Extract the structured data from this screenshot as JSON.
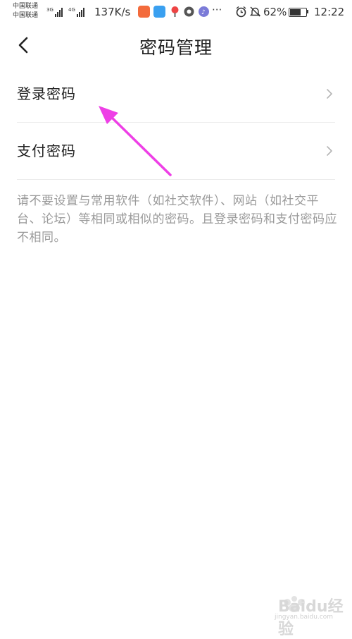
{
  "status_bar": {
    "carrier1": "中国联通",
    "carrier2": "中国联通",
    "net1": "3G",
    "net2": "4G",
    "speed": "137K/s",
    "more": "···",
    "battery": "62%",
    "time": "12:22",
    "icons": [
      "signal-icon",
      "signal-icon",
      "app-icon",
      "app-icon",
      "app-icon",
      "app-icon",
      "music-icon",
      "alarm-icon",
      "mute-icon",
      "battery-icon"
    ]
  },
  "header": {
    "title": "密码管理",
    "back_icon": "chevron-left-icon"
  },
  "menu": {
    "items": [
      {
        "label": "登录密码",
        "icon": "chevron-right-icon"
      },
      {
        "label": "支付密码",
        "icon": "chevron-right-icon"
      }
    ]
  },
  "note": "请不要设置与常用软件（如社交软件）、网站（如社交平台、论坛）等相同或相似的密码。且登录密码和支付密码应不相同。",
  "annotation": {
    "color": "#ee3fe6"
  },
  "watermark": {
    "brand": "Baidu经验",
    "url": "jingyan.baidu.com"
  }
}
